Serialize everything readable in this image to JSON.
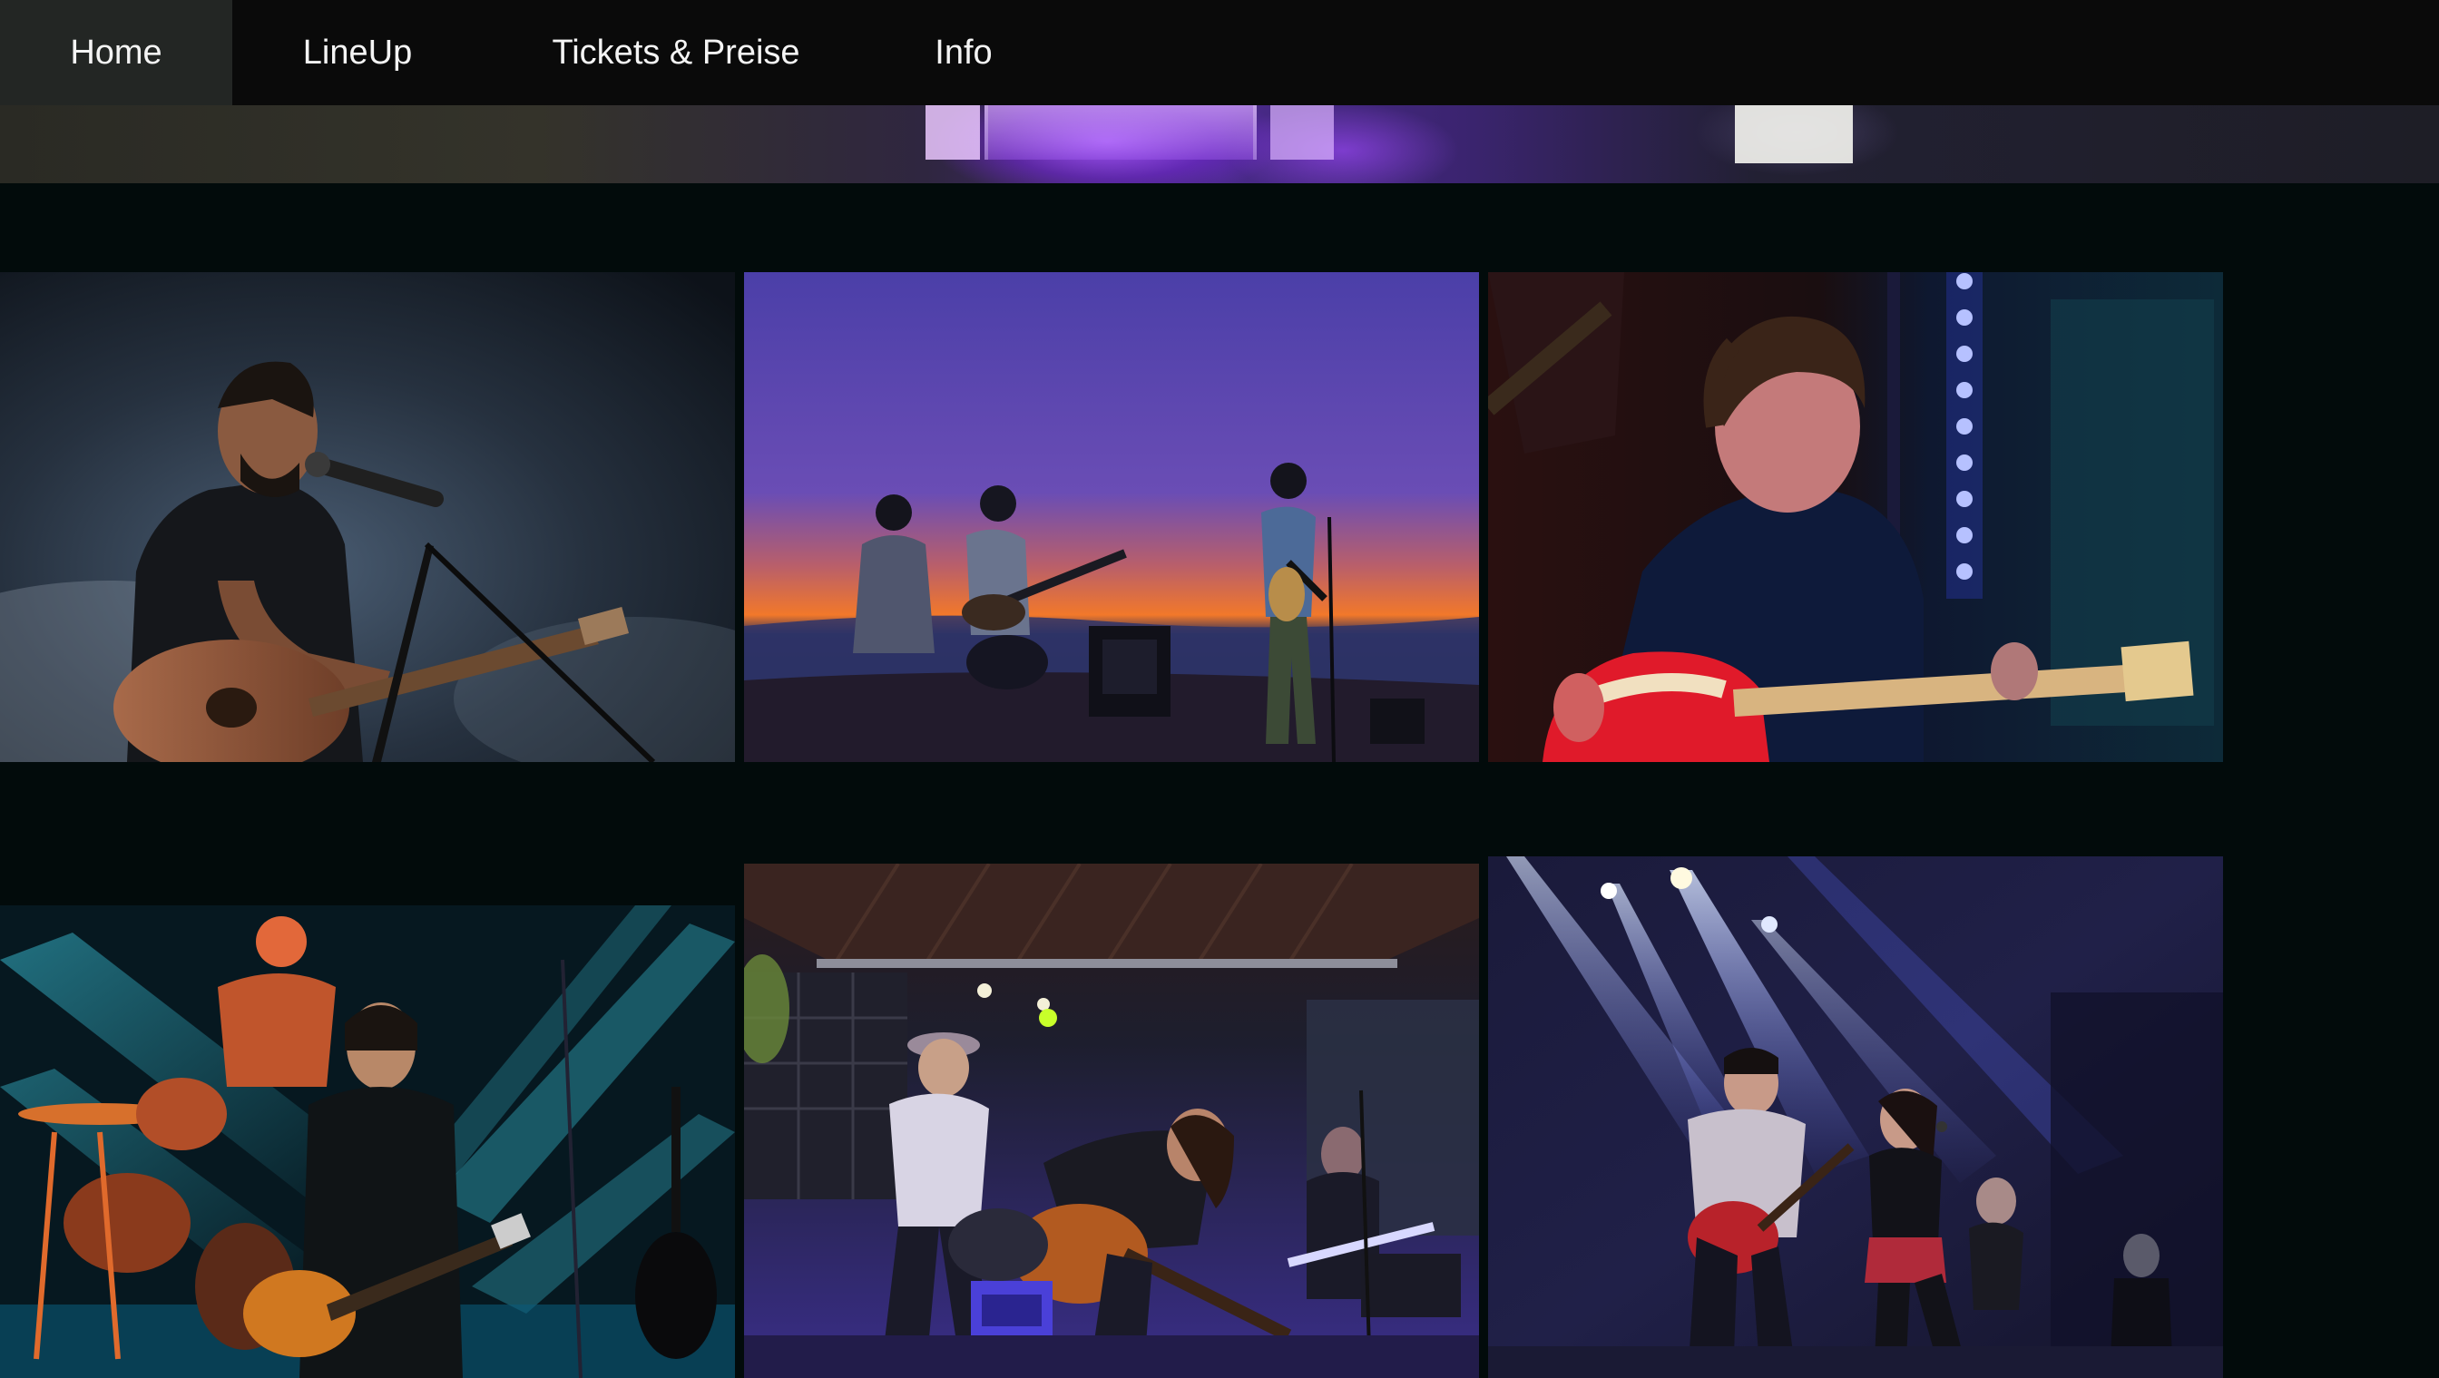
{
  "nav": {
    "items": [
      {
        "label": "Home",
        "active": true
      },
      {
        "label": "LineUp",
        "active": false
      },
      {
        "label": "Tickets & Preise",
        "active": false
      },
      {
        "label": "Info",
        "active": false
      }
    ]
  },
  "colors": {
    "nav_background": "#0a0a0a",
    "nav_active_background": "#232624",
    "nav_text": "#f4f4f4",
    "page_background": "#020b0b",
    "hero_accent": "#8a3cff"
  },
  "gallery": {
    "photos": [
      {
        "subject": "singer with acoustic guitar at microphone, blue haze"
      },
      {
        "subject": "band playing outdoors at sunset"
      },
      {
        "subject": "guitarist with electric guitar, red and blue light"
      },
      {
        "subject": "band on stage with teal light beams"
      },
      {
        "subject": "band performing on outdoor stage at night"
      },
      {
        "subject": "guitarist and singer under blue spotlights"
      }
    ]
  }
}
